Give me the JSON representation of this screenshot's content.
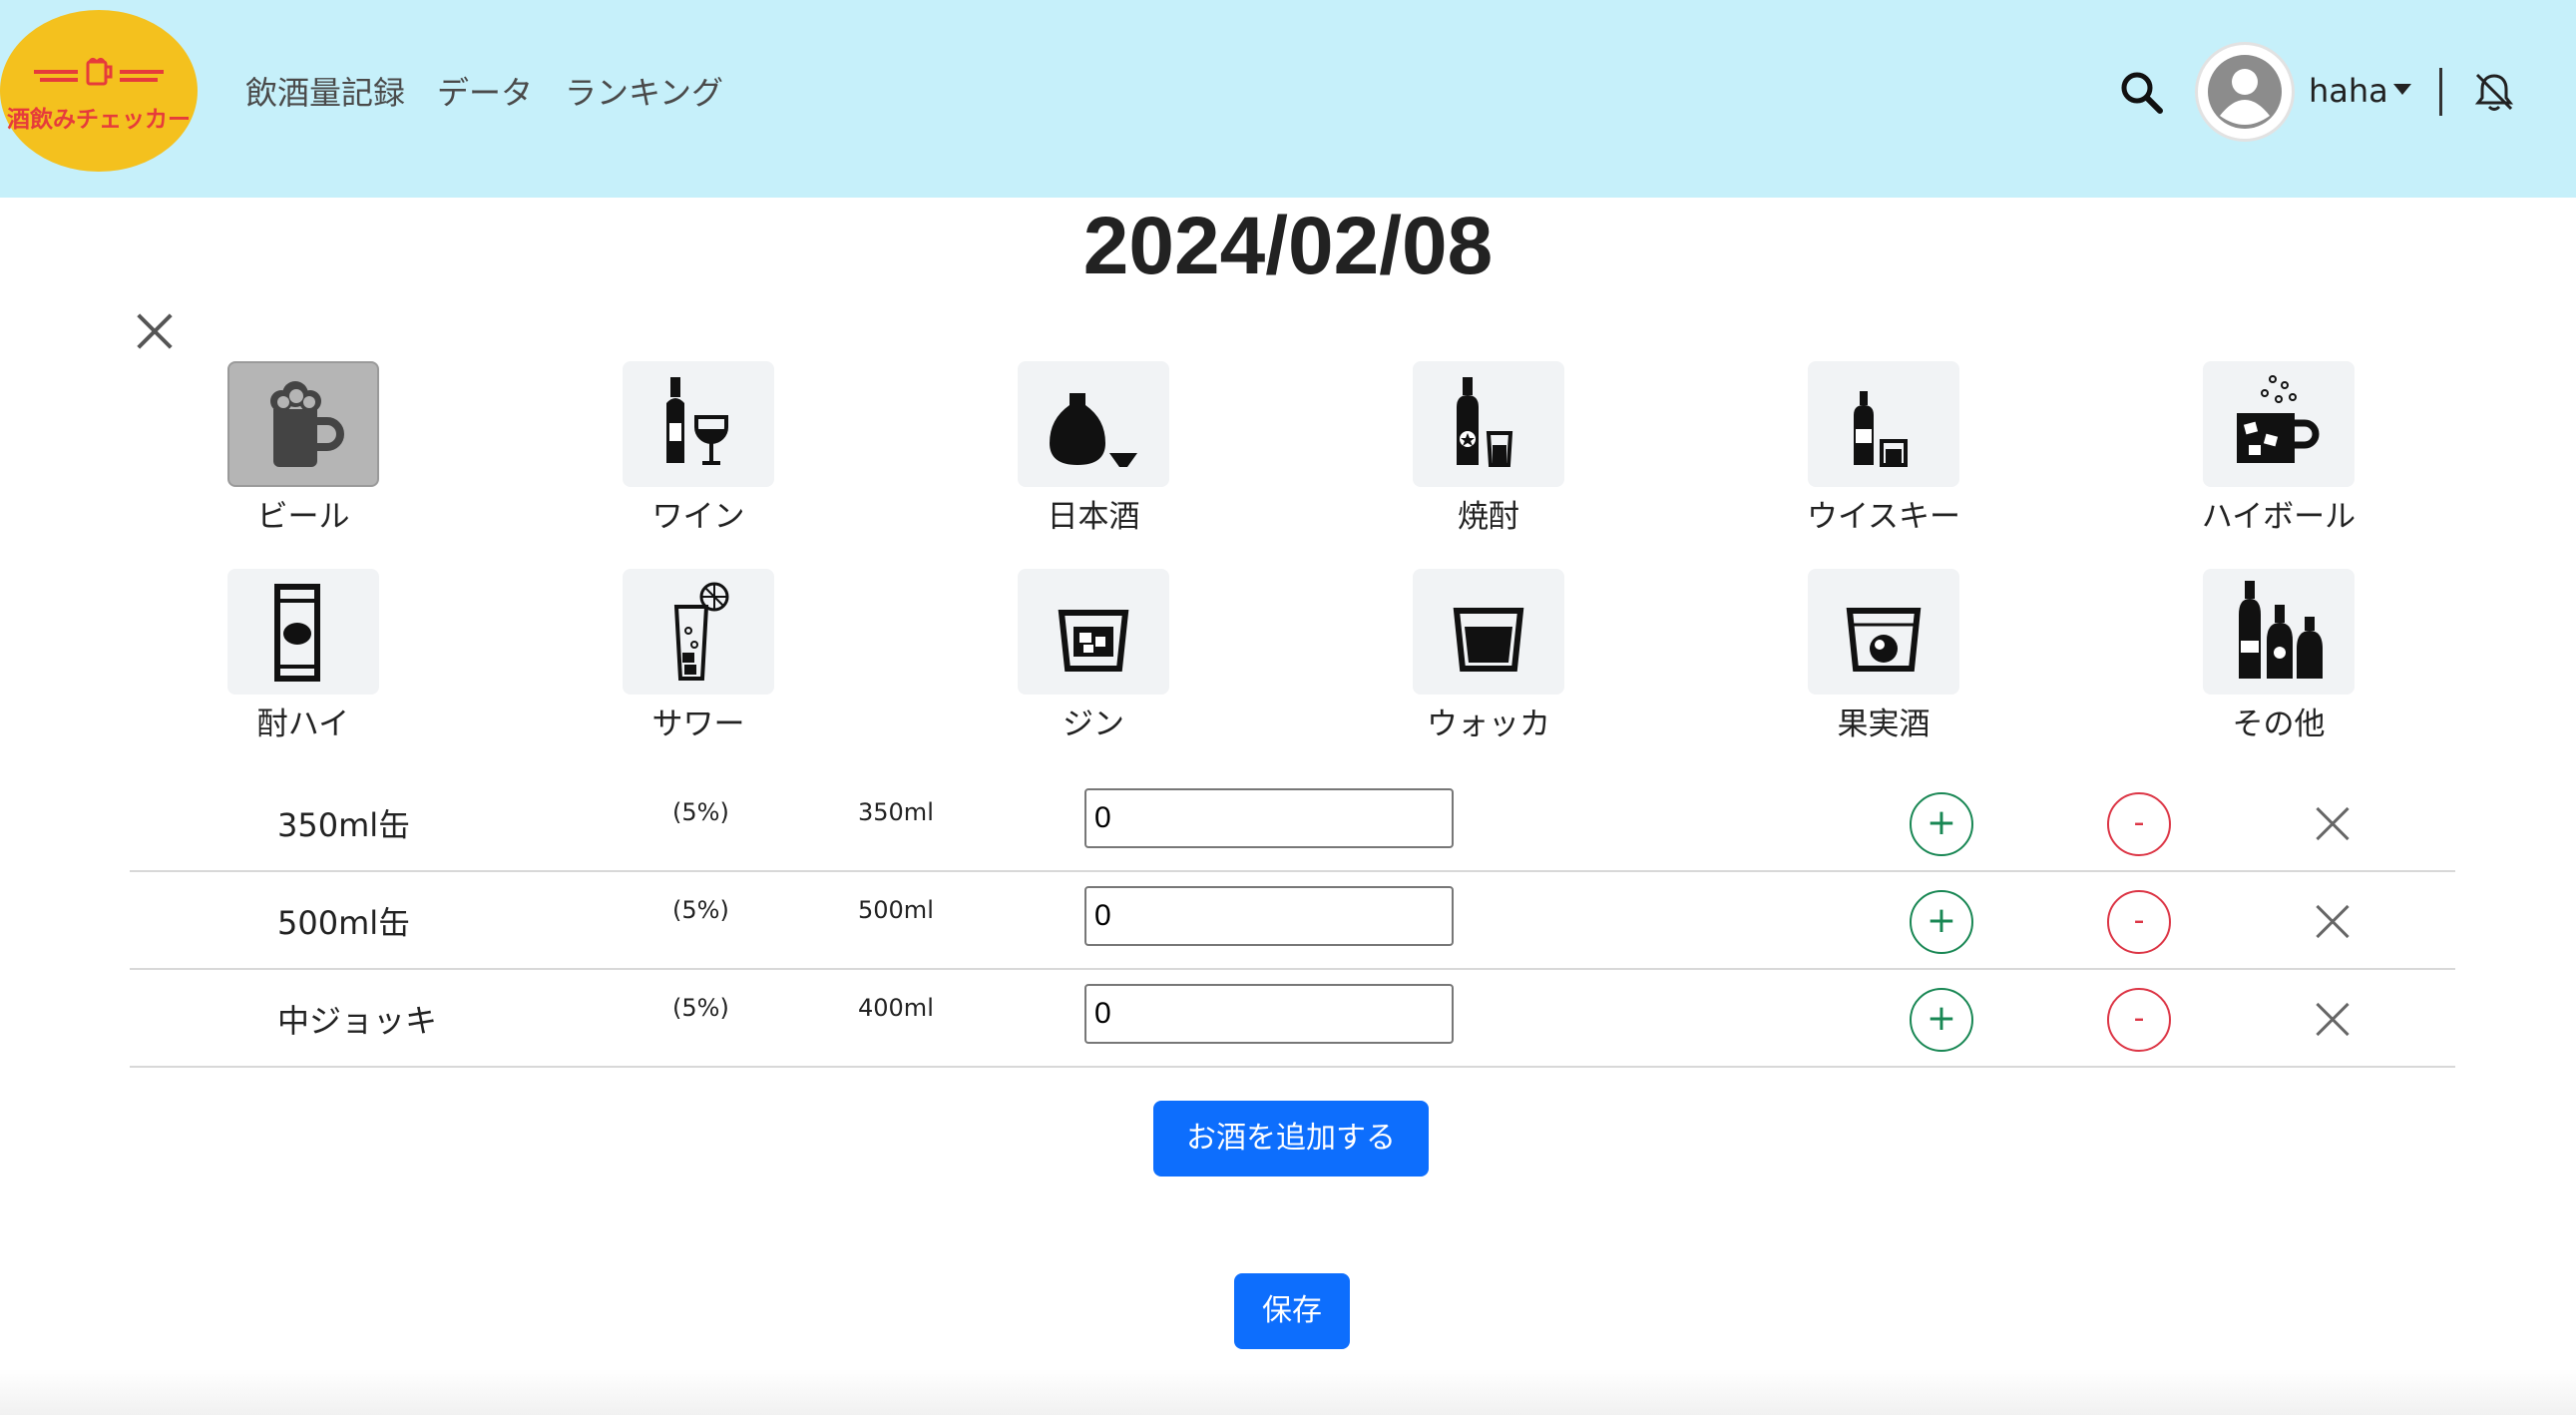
{
  "header": {
    "logo_text": "酒飲みチェッカー",
    "nav": [
      "飲酒量記録",
      "データ",
      "ランキング"
    ],
    "user_name": "haha"
  },
  "page": {
    "date": "2024/02/08"
  },
  "categories": [
    {
      "label": "ビール",
      "icon": "beer-mug-icon",
      "selected": true
    },
    {
      "label": "ワイン",
      "icon": "wine-icon",
      "selected": false
    },
    {
      "label": "日本酒",
      "icon": "sake-icon",
      "selected": false
    },
    {
      "label": "焼酎",
      "icon": "shochu-icon",
      "selected": false
    },
    {
      "label": "ウイスキー",
      "icon": "whisky-icon",
      "selected": false
    },
    {
      "label": "ハイボール",
      "icon": "highball-icon",
      "selected": false
    },
    {
      "label": "酎ハイ",
      "icon": "can-icon",
      "selected": false
    },
    {
      "label": "サワー",
      "icon": "sour-glass-icon",
      "selected": false
    },
    {
      "label": "ジン",
      "icon": "gin-glass-icon",
      "selected": false
    },
    {
      "label": "ウォッカ",
      "icon": "vodka-glass-icon",
      "selected": false
    },
    {
      "label": "果実酒",
      "icon": "fruit-liquor-icon",
      "selected": false
    },
    {
      "label": "その他",
      "icon": "bottles-icon",
      "selected": false
    }
  ],
  "drinks": [
    {
      "name": "350ml缶",
      "abv": "(5%)",
      "volume": "350ml",
      "count": "0",
      "plus": "+",
      "minus": "-"
    },
    {
      "name": "500ml缶",
      "abv": "(5%)",
      "volume": "500ml",
      "count": "0",
      "plus": "+",
      "minus": "-"
    },
    {
      "name": "中ジョッキ",
      "abv": "(5%)",
      "volume": "400ml",
      "count": "0",
      "plus": "+",
      "minus": "-"
    }
  ],
  "actions": {
    "add_label": "お酒を追加する",
    "save_label": "保存"
  },
  "colors": {
    "header_bg": "#c6f0fa",
    "logo_bg": "#f4c11e",
    "logo_text": "#e63b3b",
    "primary": "#0d6efd",
    "plus": "#198754",
    "minus": "#dc3545"
  }
}
